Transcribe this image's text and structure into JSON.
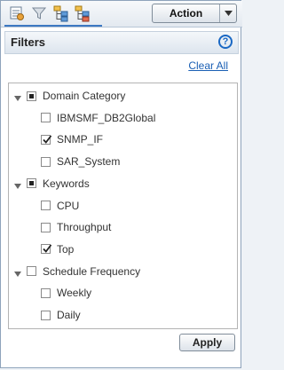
{
  "toolbar": {
    "icons": [
      "grid-view-icon",
      "filter-icon",
      "hierarchy-icon",
      "hierarchy-alt-icon"
    ],
    "action_label": "Action"
  },
  "filters": {
    "title": "Filters",
    "help_glyph": "?",
    "clear_all": "Clear All",
    "apply": "Apply",
    "groups": [
      {
        "label": "Domain Category",
        "state": "partial",
        "items": [
          {
            "label": "IBMSMF_DB2Global",
            "checked": false
          },
          {
            "label": "SNMP_IF",
            "checked": true
          },
          {
            "label": "SAR_System",
            "checked": false
          }
        ]
      },
      {
        "label": "Keywords",
        "state": "partial",
        "items": [
          {
            "label": "CPU",
            "checked": false
          },
          {
            "label": "Throughput",
            "checked": false
          },
          {
            "label": "Top",
            "checked": true
          }
        ]
      },
      {
        "label": "Schedule Frequency",
        "state": "unchecked",
        "items": [
          {
            "label": "Weekly",
            "checked": false
          },
          {
            "label": "Daily",
            "checked": false
          }
        ]
      }
    ]
  }
}
